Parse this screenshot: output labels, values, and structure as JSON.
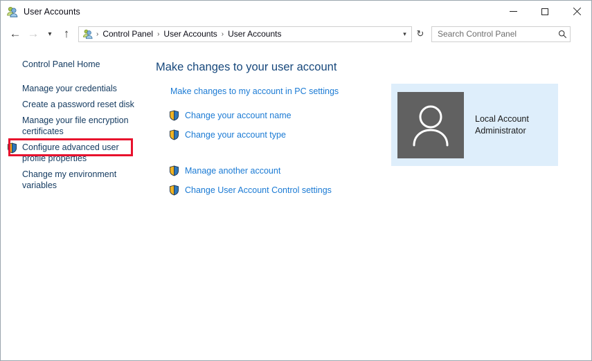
{
  "window": {
    "title": "User Accounts",
    "title_icon": "users-icon",
    "controls": {
      "minimize": "minimize-icon",
      "maximize": "maximize-icon",
      "close": "close-icon"
    }
  },
  "navbar": {
    "back": "back-arrow-icon",
    "forward": "forward-arrow-icon",
    "recent": "chevron-down-icon",
    "up": "up-arrow-icon",
    "breadcrumb_icon": "users-icon",
    "breadcrumbs": [
      "Control Panel",
      "User Accounts",
      "User Accounts"
    ],
    "separator": "›",
    "address_dropdown": "chevron-down-icon",
    "refresh": "refresh-icon"
  },
  "search": {
    "placeholder": "Search Control Panel",
    "value": "",
    "icon": "search-icon"
  },
  "help": {
    "label": "?",
    "name": "help-icon"
  },
  "sidebar": {
    "items": [
      {
        "label": "Control Panel Home",
        "shield": false
      },
      {
        "label": "Manage your credentials",
        "shield": false
      },
      {
        "label": "Create a password reset disk",
        "shield": false,
        "highlighted": true
      },
      {
        "label": "Manage your file encryption certificates",
        "shield": false
      },
      {
        "label": "Configure advanced user profile properties",
        "shield": true
      },
      {
        "label": "Change my environment variables",
        "shield": false
      }
    ]
  },
  "main": {
    "heading": "Make changes to your user account",
    "pc_settings_link": "Make changes to my account in PC settings",
    "tasks_group_one": [
      {
        "label": "Change your account name",
        "shield": true
      },
      {
        "label": "Change your account type",
        "shield": true
      }
    ],
    "tasks_group_two": [
      {
        "label": "Manage another account",
        "shield": true
      },
      {
        "label": "Change User Account Control settings",
        "shield": true
      }
    ]
  },
  "account": {
    "avatar": "user-avatar-icon",
    "line1": "Local Account",
    "line2": "Administrator"
  },
  "annotation": {
    "highlight_color": "#e8112d",
    "target": "Create a password reset disk"
  },
  "colors": {
    "heading": "#17487c",
    "link": "#1a7ad4",
    "sidebar_link": "#12395f",
    "panel_bg": "#deeefb",
    "avatar_bg": "#616161",
    "help_bg": "#1569b5"
  }
}
